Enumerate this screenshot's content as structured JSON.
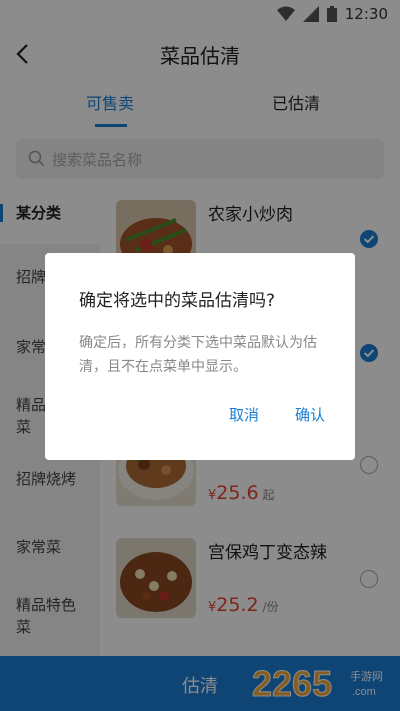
{
  "status_bar": {
    "time": "12:30"
  },
  "header": {
    "title": "菜品估清",
    "back_icon": "chevron-left-icon"
  },
  "tabs": [
    {
      "label": "可售卖",
      "active": true
    },
    {
      "label": "已估清",
      "active": false
    }
  ],
  "search": {
    "placeholder": "搜索菜品名称",
    "icon": "search-icon"
  },
  "sidebar": {
    "items": [
      {
        "label": "某分类",
        "active": true
      },
      {
        "label": "招牌烧烤"
      },
      {
        "label": "家常菜"
      },
      {
        "label": "精品特色菜"
      },
      {
        "label": "招牌烧烤"
      },
      {
        "label": "家常菜"
      },
      {
        "label": "精品特色菜"
      }
    ]
  },
  "dishes": [
    {
      "name": "农家小炒肉",
      "checked": true
    },
    {
      "name": "",
      "checked": true
    },
    {
      "name": "",
      "price": "25.6",
      "currency": "¥",
      "unit": "起",
      "checked": false
    },
    {
      "name": "宫保鸡丁变态辣",
      "price": "25.2",
      "currency": "¥",
      "unit": "/份",
      "checked": false
    }
  ],
  "bottom_bar": {
    "label": "估清"
  },
  "watermark": {
    "text": "2265",
    "sub": "手游网",
    "domain": ".com"
  },
  "dialog": {
    "title": "确定将选中的菜品估清吗?",
    "message": "确定后，所有分类下选中菜品默认为估清，且不在点菜单中显示。",
    "cancel": "取消",
    "confirm": "确认"
  },
  "colors": {
    "accent": "#1a7fd4",
    "price": "#e5432d",
    "overlay": "rgba(0,0,0,0.45)"
  }
}
